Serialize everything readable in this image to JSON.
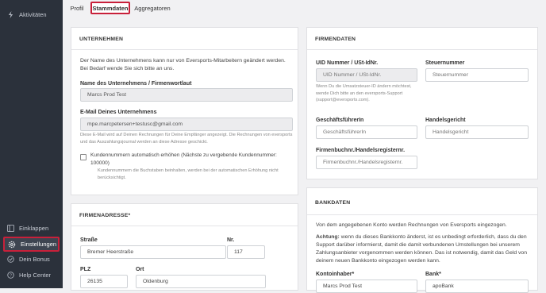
{
  "sidebar": {
    "top_item": {
      "label": "Aktivitäten",
      "icon": "activity-icon"
    },
    "bottom_items": [
      {
        "label": "Einklappen",
        "icon": "collapse-icon"
      },
      {
        "label": "Einstellungen",
        "icon": "gear-icon"
      },
      {
        "label": "Dein Bonus",
        "icon": "gift-icon"
      },
      {
        "label": "Help Center",
        "icon": "help-icon"
      }
    ]
  },
  "tabs": [
    {
      "label": "Profil"
    },
    {
      "label": "Stammdaten"
    },
    {
      "label": "Aggregatoren"
    }
  ],
  "unternehmen": {
    "title": "UNTERNEHMEN",
    "intro": "Der Name des Unternehmens kann nur von Eversports-Mitarbeitern geändert werden. Bei Bedarf wende Sie sich bitte an uns.",
    "name_label": "Name des Unternehmens / Firmenwortlaut",
    "name_value": "Marcs Prod Test",
    "email_label": "E-Mail Deines Unternehmens",
    "email_value": "mpe.marcpetersen+testusc@gmail.com",
    "email_hint": "Diese E-Mail wird auf Deinen Rechnungen für Deine Empfänger angezeigt. Die Rechnungen von eversports und das Auszahlungsjournal werden an diese Adresse geschickt.",
    "checkbox_label": "Kundennummern automatisch erhöhen (Nächste zu vergebende Kundennummer: 100000)",
    "checkbox_hint": "Kundennummern die Buchstaben beinhalten, werden bei der automatischen Erhöhung nicht berücksichtigt."
  },
  "firmenadresse": {
    "title": "FIRMENADRESSE*",
    "street_label": "Straße",
    "street_value": "Bremer Heerstraße",
    "nr_label": "Nr.",
    "nr_value": "117",
    "plz_label": "PLZ",
    "plz_value": "26135",
    "ort_label": "Ort",
    "ort_value": "Oldenburg"
  },
  "firmendaten": {
    "title": "FIRMENDATEN",
    "uid_label": "UID Nummer / USt-IdNr.",
    "uid_placeholder": "UID Nummer / USt-IdNr.",
    "uid_hint": "Wenn Du die Umsatzsteuer-ID ändern möchtest, wende Dich bitte an den eversports-Support (support@eversports.com).",
    "steuer_label": "Steuernummer",
    "steuer_placeholder": "Steuernummer",
    "gf_label": "GeschäftsführerIn",
    "gf_placeholder": "GeschäftsführerIn",
    "hg_label": "Handelsgericht",
    "hg_placeholder": "Handelsgericht",
    "fb_label": "Firmenbuchnr./Handelsregisternr.",
    "fb_placeholder": "Firmenbuchnr./Handelsregisternr."
  },
  "bankdaten": {
    "title": "BANKDATEN",
    "intro": "Von dem angegebenen Konto werden Rechnungen von Eversports eingezogen.",
    "achtung_bold": "Achtung:",
    "achtung_text": " wenn du dieses Bankkonto änderst, ist es unbedingt erforderlich, dass du den Support darüber informierst, damit die damit verbundenen Umstellungen bei unserem Zahlungsanbieter vorgenommen werden können. Das ist notwendig, damit das Geld von deinem neuen Bankkonto eingezogen werden kann.",
    "inhaber_label": "Kontoinhaber*",
    "inhaber_value": "Marcs Prod Test",
    "bank_label": "Bank*",
    "bank_value": "apoBank"
  }
}
